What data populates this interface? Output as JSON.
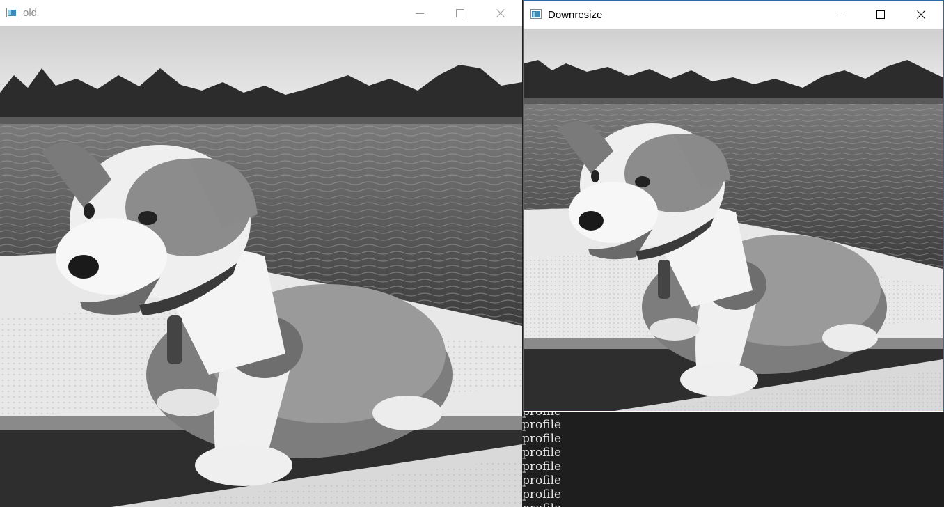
{
  "windows": {
    "old": {
      "title": "old"
    },
    "downresize": {
      "title": "Downresize"
    }
  },
  "console": {
    "lines": [
      "profile",
      "profile",
      "profile",
      "profile",
      "profile",
      "profile",
      "profile",
      "profile"
    ]
  },
  "icons": {
    "app": "app-window-icon",
    "minimize": "minimize-icon",
    "maximize": "maximize-icon",
    "close": "close-icon"
  },
  "colors": {
    "active_border": "#2b6aa6",
    "console_bg": "#1e1e1e",
    "console_text": "#e6e6e6"
  }
}
